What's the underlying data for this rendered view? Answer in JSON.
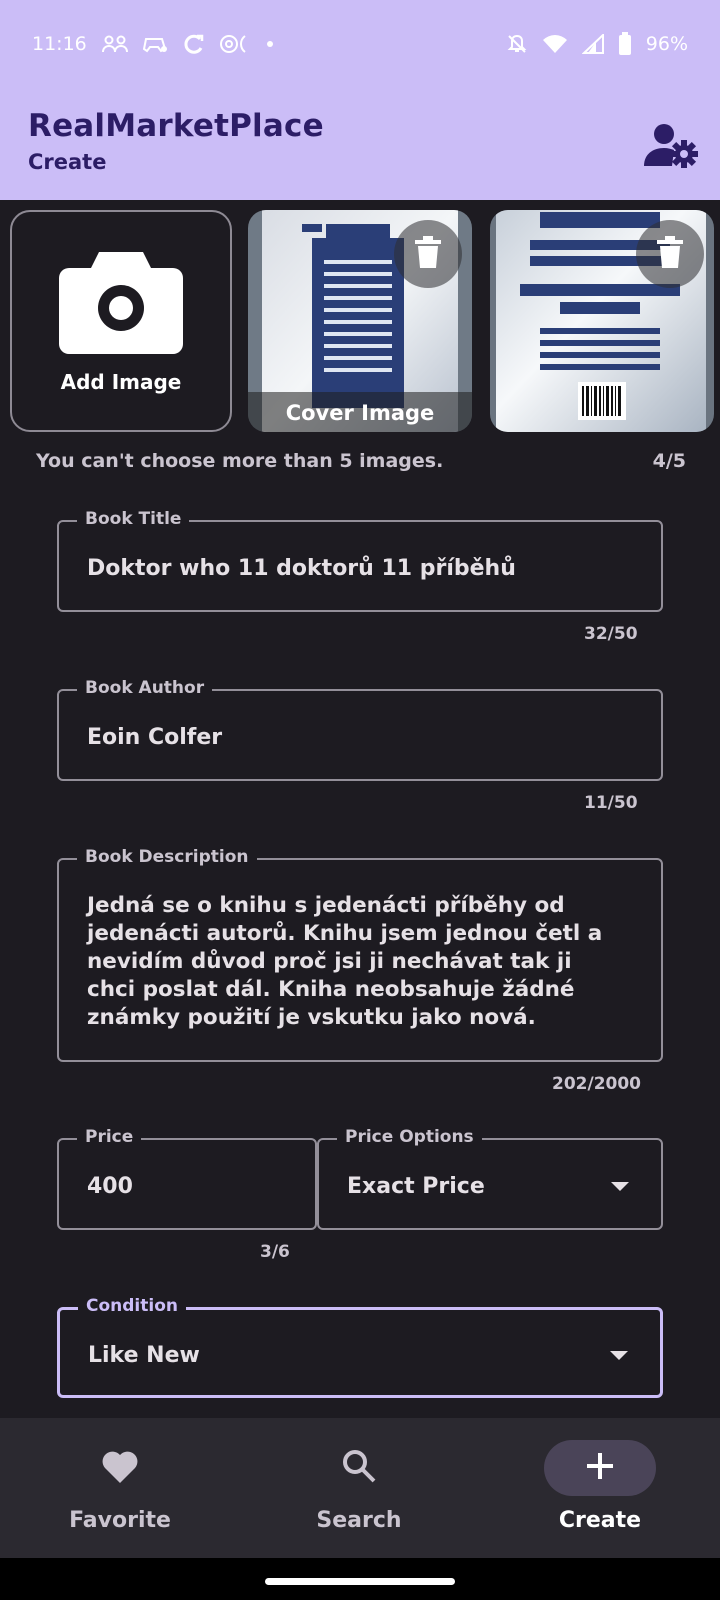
{
  "status_bar": {
    "time": "11:16",
    "battery": "96%"
  },
  "app_bar": {
    "title": "RealMarketPlace",
    "subtitle": "Create",
    "account_icon": "manage-accounts-icon"
  },
  "images": {
    "add_label": "Add Image",
    "cover_caption": "Cover Image",
    "limit_message": "You can't choose more than 5 images.",
    "count": "4/5"
  },
  "form": {
    "title": {
      "label": "Book Title",
      "value": "Doktor who 11 doktorů 11 příběhů",
      "counter": "32/50"
    },
    "author": {
      "label": "Book Author",
      "value": "Eoin Colfer",
      "counter": "11/50"
    },
    "description": {
      "label": "Book Description",
      "value": "Jedná se o knihu s jedenácti příběhy od jedenácti autorů. Knihu jsem jednou četl a nevidím důvod proč jsi ji nechávat tak ji chci poslat dál. Kniha neobsahuje žádné známky použití je vskutku jako nová.",
      "counter": "202/2000"
    },
    "price": {
      "label": "Price",
      "value": "400",
      "counter": "3/6"
    },
    "price_options": {
      "label": "Price Options",
      "value": "Exact Price"
    },
    "condition": {
      "label": "Condition",
      "value": "Like New"
    }
  },
  "bottom_nav": {
    "items": [
      {
        "label": "Favorite",
        "icon": "heart-icon"
      },
      {
        "label": "Search",
        "icon": "search-icon"
      },
      {
        "label": "Create",
        "icon": "plus-icon",
        "active": true
      }
    ]
  },
  "colors": {
    "accent": "#cbbdf7",
    "background": "#1d1b21",
    "nav_background": "#2b2930"
  }
}
